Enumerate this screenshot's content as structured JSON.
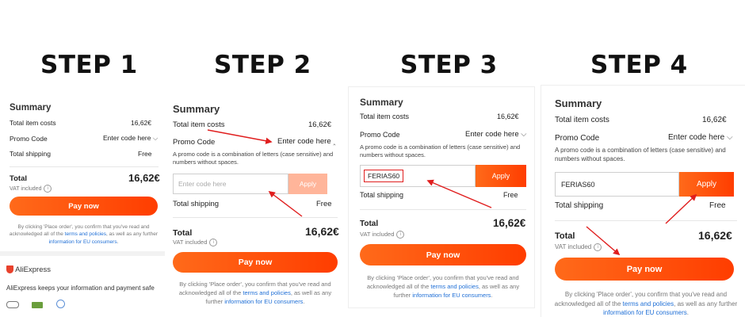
{
  "steps": [
    "STEP 1",
    "STEP 2",
    "STEP 3",
    "STEP 4"
  ],
  "summary": {
    "title": "Summary",
    "total_item_costs_label": "Total item costs",
    "total_item_costs_value": "16,62€",
    "promo_code_label": "Promo Code",
    "enter_code_link": "Enter code here",
    "promo_hint": "A promo code is a combination of letters (case sensitive) and numbers without spaces.",
    "input_placeholder": "Enter code here",
    "promo_value": "FERIAS60",
    "apply_label": "Apply",
    "total_shipping_label": "Total shipping",
    "total_shipping_value": "Free",
    "total_label": "Total",
    "total_value": "16,62€",
    "vat_label": "VAT included",
    "pay_button": "Pay now",
    "footer_text_1": "By clicking 'Place order', you confirm that you've read and acknowledged all of the",
    "footer_link_1": "terms and policies",
    "footer_text_2": ", as well as any further",
    "footer_link_2": "information for EU consumers",
    "footer_text_3": "."
  },
  "aliexpress": {
    "brand": "AliExpress",
    "safety_note": "AliExpress keeps your information and payment safe"
  },
  "colors": {
    "accent": "#ff4a0d",
    "link": "#1f6fd6",
    "annotation_arrow": "#e01e1e",
    "apply_disabled": "#ffb59a"
  },
  "icons": [
    "chevron-down-icon",
    "chevron-up-icon",
    "info-icon",
    "shield-icon",
    "arrow-annotation-icon"
  ]
}
